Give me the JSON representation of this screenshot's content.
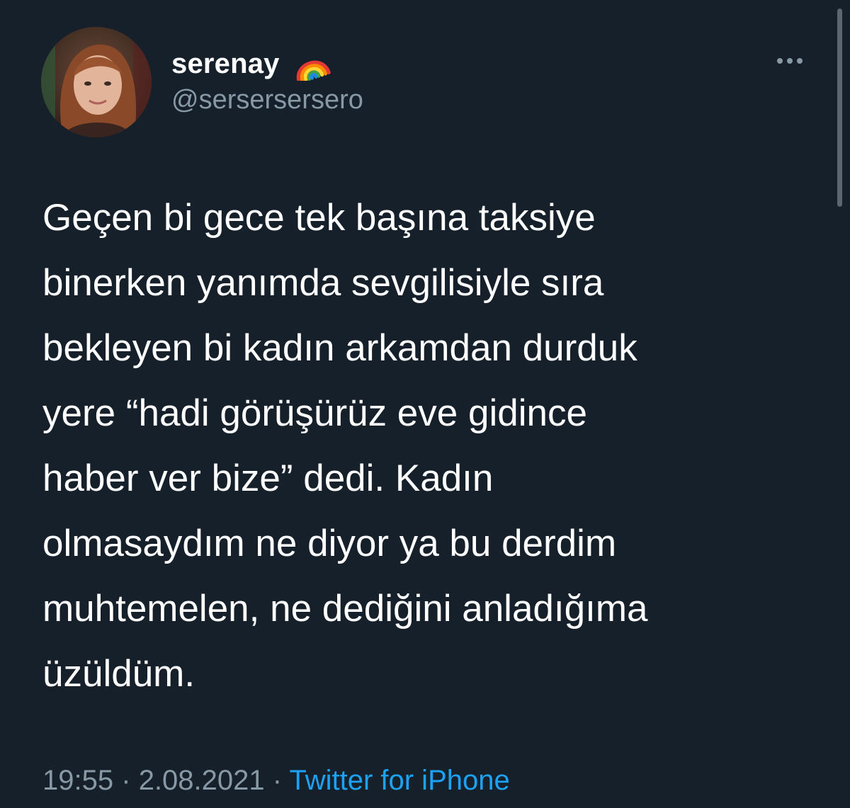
{
  "author": {
    "display_name": "serenay",
    "emoji": "rainbow-icon",
    "handle": "@serserserserо",
    "avatar": "avatar-photo"
  },
  "more_button": {
    "icon": "more-horizontal-icon"
  },
  "tweet": {
    "text_lines": [
      "Geçen bi gece tek başına taksiye",
      "binerken yanımda sevgilisiyle sıra",
      "bekleyen bi kadın arkamdan durduk",
      "yere “hadi görüşürüz eve gidince",
      "haber ver bize” dedi. Kadın",
      "olmasaydım ne diyor ya bu derdim",
      "muhtemelen, ne dediğini anladığıma",
      "üzüldüm."
    ]
  },
  "meta": {
    "time": "19:55",
    "separator": "·",
    "date": "2.08.2021",
    "source": "Twitter for iPhone"
  },
  "colors": {
    "background": "#15202b",
    "text": "#ffffff",
    "secondary": "#8899a6",
    "link": "#1da1f2"
  }
}
